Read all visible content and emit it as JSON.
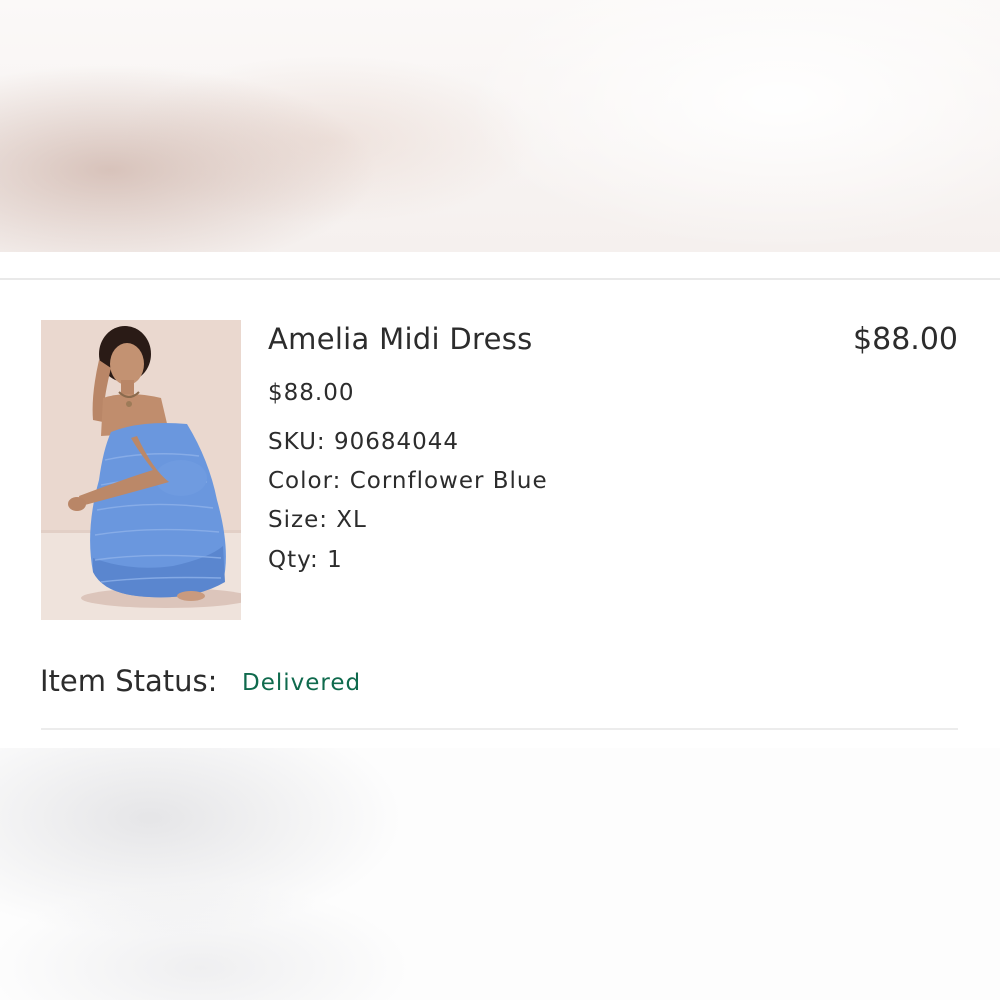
{
  "order_item": {
    "name": "Amelia Midi Dress",
    "line_total": "$88.00",
    "unit_price": "$88.00",
    "sku": "SKU: 90684044",
    "color": "Color: Cornflower Blue",
    "size": "Size: XL",
    "qty": "Qty: 1",
    "image_alt": "product-photo-blue-dress"
  },
  "status": {
    "label": "Item Status:",
    "value": "Delivered",
    "value_color": "#0f6a4d"
  }
}
